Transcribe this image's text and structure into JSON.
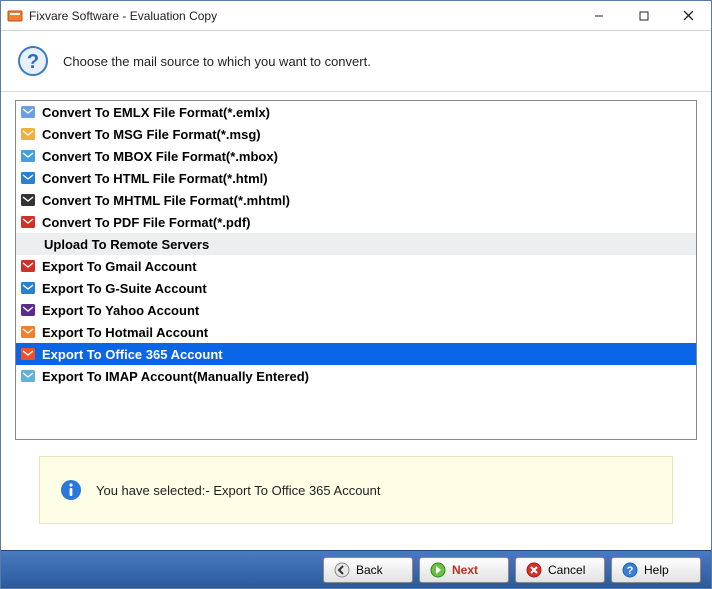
{
  "window": {
    "title": "Fixvare Software - Evaluation Copy",
    "subtitle": "Choose the mail source to which you want to convert."
  },
  "list": {
    "items": [
      {
        "label": "Convert To EMLX File Format(*.emlx)",
        "icon": "emlx",
        "selected": false
      },
      {
        "label": "Convert To MSG File Format(*.msg)",
        "icon": "msg",
        "selected": false
      },
      {
        "label": "Convert To MBOX File Format(*.mbox)",
        "icon": "mbox",
        "selected": false
      },
      {
        "label": "Convert To HTML File Format(*.html)",
        "icon": "html",
        "selected": false
      },
      {
        "label": "Convert To MHTML File Format(*.mhtml)",
        "icon": "mhtml",
        "selected": false
      },
      {
        "label": "Convert To PDF File Format(*.pdf)",
        "icon": "pdf",
        "selected": false
      },
      {
        "label": "Upload To Remote Servers",
        "header": true
      },
      {
        "label": "Export To Gmail Account",
        "icon": "gmail",
        "selected": false
      },
      {
        "label": "Export To G-Suite Account",
        "icon": "gsuite",
        "selected": false
      },
      {
        "label": "Export To Yahoo Account",
        "icon": "yahoo",
        "selected": false
      },
      {
        "label": "Export To Hotmail Account",
        "icon": "hotmail",
        "selected": false
      },
      {
        "label": "Export To Office 365 Account",
        "icon": "office365",
        "selected": true
      },
      {
        "label": "Export To IMAP Account(Manually Entered)",
        "icon": "imap",
        "selected": false
      }
    ]
  },
  "info": {
    "text": "You have selected:- Export To Office 365 Account"
  },
  "buttons": {
    "back": "Back",
    "next": "Next",
    "cancel": "Cancel",
    "help": "Help"
  },
  "iconColors": {
    "emlx": "#6aa0e0",
    "msg": "#f0b040",
    "mbox": "#44a0d8",
    "html": "#2a80d0",
    "mhtml": "#333333",
    "pdf": "#d03028",
    "gmail": "#d03028",
    "gsuite": "#2a80d0",
    "yahoo": "#5a2a90",
    "hotmail": "#f08030",
    "office365": "#f05028",
    "imap": "#60b0d8"
  }
}
